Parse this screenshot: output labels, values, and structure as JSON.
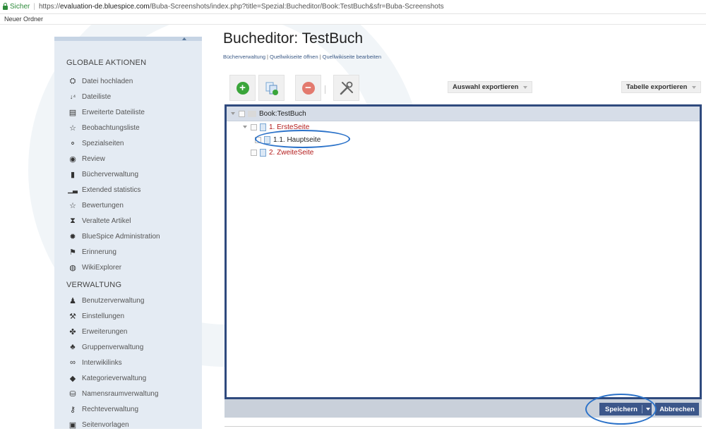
{
  "browser": {
    "secure_label": "Sicher",
    "url_prefix": "https://",
    "url_host": "evaluation-de.bluespice.com",
    "url_path": "/Buba-Screenshots/index.php?title=Spezial:Bucheditor/Book:TestBuch&sfr=Buba-Screenshots",
    "bookmark": "Neuer Ordner"
  },
  "sidebar": {
    "global_heading": "GLOBALE AKTIONEN",
    "global_items": [
      {
        "label": "Datei hochladen",
        "icon": "upload-icon"
      },
      {
        "label": "Dateiliste",
        "icon": "sort-icon"
      },
      {
        "label": "Erweiterte Dateiliste",
        "icon": "list-icon"
      },
      {
        "label": "Beobachtungsliste",
        "icon": "star-icon"
      },
      {
        "label": "Spezialseiten",
        "icon": "special-icon"
      },
      {
        "label": "Review",
        "icon": "eye-icon"
      },
      {
        "label": "Bücherverwaltung",
        "icon": "book-icon"
      },
      {
        "label": "Extended statistics",
        "icon": "chart-icon"
      },
      {
        "label": "Bewertungen",
        "icon": "star-icon"
      },
      {
        "label": "Veraltete Artikel",
        "icon": "hourglass-icon"
      },
      {
        "label": "BlueSpice Administration",
        "icon": "gear-icon"
      },
      {
        "label": "Erinnerung",
        "icon": "flag-icon"
      },
      {
        "label": "WikiExplorer",
        "icon": "globe-icon"
      }
    ],
    "admin_heading": "VERWALTUNG",
    "admin_items": [
      {
        "label": "Benutzerverwaltung",
        "icon": "user-icon"
      },
      {
        "label": "Einstellungen",
        "icon": "wrench-icon"
      },
      {
        "label": "Erweiterungen",
        "icon": "puzzle-icon"
      },
      {
        "label": "Gruppenverwaltung",
        "icon": "group-icon"
      },
      {
        "label": "Interwikilinks",
        "icon": "link-icon"
      },
      {
        "label": "Kategorieverwaltung",
        "icon": "tag-icon"
      },
      {
        "label": "Namensraumverwaltung",
        "icon": "namespace-icon"
      },
      {
        "label": "Rechteverwaltung",
        "icon": "key-icon"
      },
      {
        "label": "Seitenvorlagen",
        "icon": "template-icon"
      }
    ]
  },
  "main": {
    "title": "Bucheditor: TestBuch",
    "links": [
      "Bücherverwaltung",
      "Quellwikiseite öffnen",
      "Quellwikiseite bearbeiten"
    ],
    "export_selection": "Auswahl exportieren",
    "export_table": "Tabelle exportieren",
    "tree": {
      "root": "Book:TestBuch",
      "nodes": [
        {
          "label": "1. ErsteSeite",
          "level": 1
        },
        {
          "label": "1.1. Hauptseite",
          "level": 2
        },
        {
          "label": "2. ZweiteSeite",
          "level": 1
        }
      ]
    },
    "save_label": "Speichern",
    "cancel_label": "Abbrechen"
  },
  "colors": {
    "accent": "#3c578a",
    "highlight": "#2b72c9",
    "link_red": "#b31b1b",
    "sidebar_bg": "#e4ebf3"
  }
}
